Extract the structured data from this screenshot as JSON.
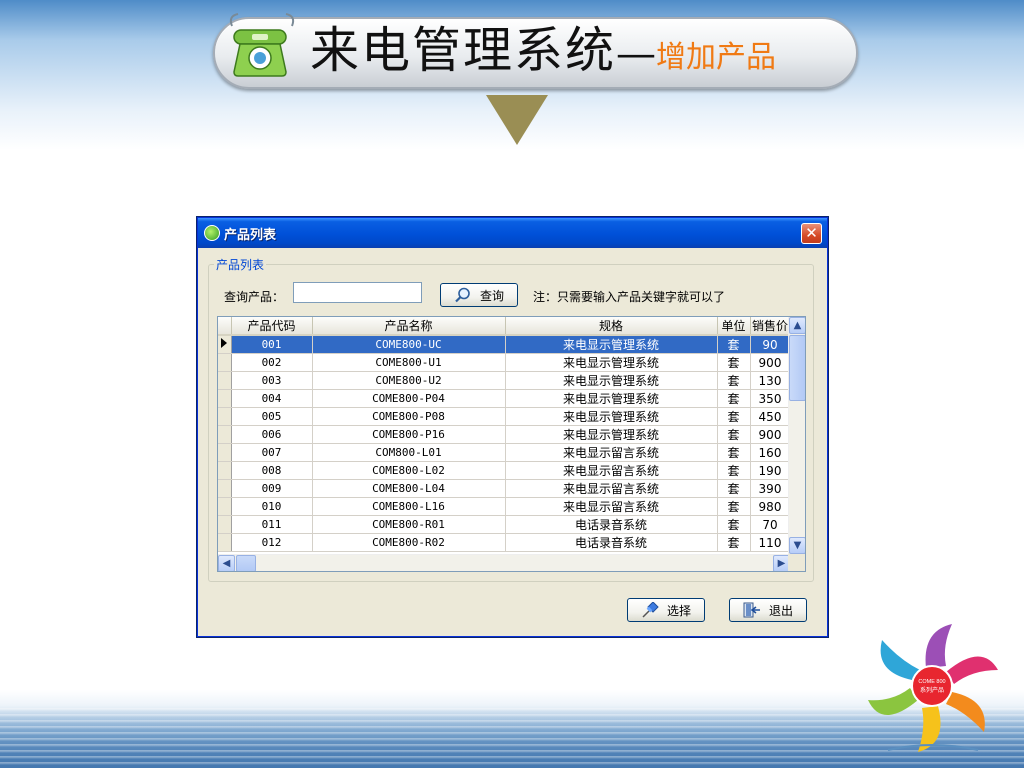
{
  "header": {
    "title_main": "来电管理系统",
    "title_dash": "—",
    "title_sub": "增加产品"
  },
  "dialog": {
    "title": "产品列表",
    "close_glyph": "✕",
    "group_label": "产品列表",
    "search_label": "查询产品：",
    "search_value": "",
    "search_button": "查询",
    "hint": "注：只需要输入产品关键字就可以了",
    "select_button": "选择",
    "exit_button": "退出"
  },
  "grid": {
    "columns": [
      "产品代码",
      "产品名称",
      "规格",
      "单位",
      "销售价"
    ],
    "selected_row": 0,
    "rows": [
      [
        "001",
        "COME800-UC",
        "来电显示管理系统",
        "套",
        "90"
      ],
      [
        "002",
        "COME800-U1",
        "来电显示管理系统",
        "套",
        "900"
      ],
      [
        "003",
        "COME800-U2",
        "来电显示管理系统",
        "套",
        "130"
      ],
      [
        "004",
        "COME800-P04",
        "来电显示管理系统",
        "套",
        "350"
      ],
      [
        "005",
        "COME800-P08",
        "来电显示管理系统",
        "套",
        "450"
      ],
      [
        "006",
        "COME800-P16",
        "来电显示管理系统",
        "套",
        "900"
      ],
      [
        "007",
        "COM800-L01",
        "来电显示留言系统",
        "套",
        "160"
      ],
      [
        "008",
        "COME800-L02",
        "来电显示留言系统",
        "套",
        "190"
      ],
      [
        "009",
        "COME800-L04",
        "来电显示留言系统",
        "套",
        "390"
      ],
      [
        "010",
        "COME800-L16",
        "来电显示留言系统",
        "套",
        "980"
      ],
      [
        "011",
        "COME800-R01",
        "电话录音系统",
        "套",
        "70"
      ],
      [
        "012",
        "COME800-R02",
        "电话录音系统",
        "套",
        "110"
      ]
    ]
  },
  "logo": {
    "center_line1": "COME 800",
    "center_line2": "系列产品"
  },
  "colors": {
    "accent_title_sub": "#f07a14",
    "selection": "#316ac5",
    "titlebar": "#0050d8"
  },
  "icons": [
    "phone-icon",
    "dialog-app-icon",
    "close-icon",
    "search-icon",
    "pin-icon",
    "exit-door-icon",
    "down-arrow-icon"
  ]
}
